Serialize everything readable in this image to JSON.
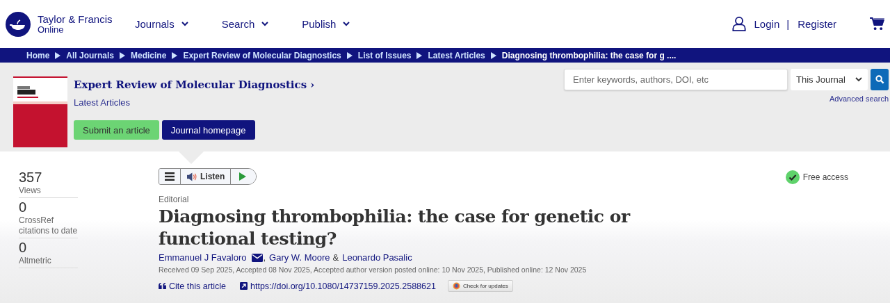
{
  "header": {
    "logo": {
      "name": "Taylor & Francis",
      "sub": "Online"
    },
    "nav": [
      {
        "label": "Journals"
      },
      {
        "label": "Search"
      },
      {
        "label": "Publish"
      }
    ],
    "account": {
      "login": "Login",
      "divider": "|",
      "register": "Register"
    }
  },
  "breadcrumbs": [
    {
      "label": "Home",
      "current": false
    },
    {
      "label": "All Journals",
      "current": false
    },
    {
      "label": "Medicine",
      "current": false
    },
    {
      "label": "Expert Review of Molecular Diagnostics",
      "current": false
    },
    {
      "label": "List of Issues",
      "current": false
    },
    {
      "label": "Latest Articles",
      "current": false
    },
    {
      "label": "Diagnosing thrombophilia: the case for g ....",
      "current": true
    }
  ],
  "journal": {
    "title": "Expert Review of Molecular Diagnostics",
    "chevron": "›",
    "issue": "Latest Articles",
    "buttons": [
      {
        "label": "Submit an article",
        "kind": "submit"
      },
      {
        "label": "Journal homepage",
        "kind": "home"
      }
    ]
  },
  "search": {
    "placeholder": "Enter keywords, authors, DOI, etc",
    "scope": "This Journal",
    "advanced": "Advanced search"
  },
  "metrics": [
    {
      "value": "357",
      "label": "Views"
    },
    {
      "value": "0",
      "label": "CrossRef citations to date"
    },
    {
      "value": "0",
      "label": "Altmetric"
    }
  ],
  "listen": {
    "label": "Listen"
  },
  "access": {
    "label": "Free access"
  },
  "article": {
    "type": "Editorial",
    "title": "Diagnosing thrombophilia: the case for genetic or functional testing?",
    "authors": [
      {
        "name": "Emmanuel J Favaloro",
        "corresponding": true,
        "separator": ","
      },
      {
        "name": "Gary W. Moore",
        "corresponding": false,
        "separator": "&"
      },
      {
        "name": "Leonardo Pasalic",
        "corresponding": false
      }
    ],
    "dates": "Received 09 Sep 2025, Accepted 08 Nov 2025, Accepted author version posted online: 10 Nov 2025, Published online: 12 Nov 2025",
    "cite": "Cite this article",
    "doi": "https://doi.org/10.1080/14737159.2025.2588621",
    "updates": "Check for updates"
  }
}
